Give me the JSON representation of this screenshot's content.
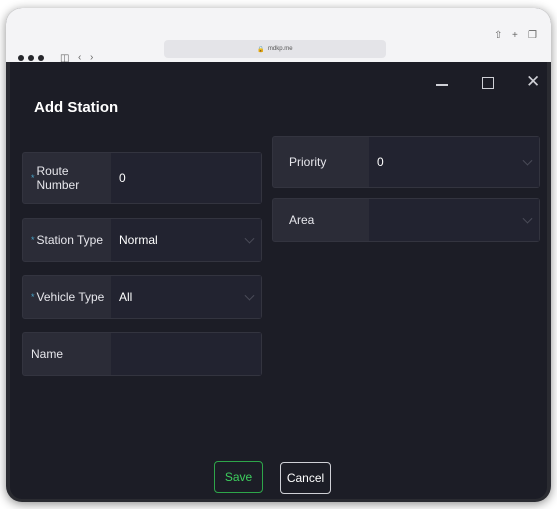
{
  "browser": {
    "url": "mdkp.me"
  },
  "modal": {
    "title": "Add Station"
  },
  "form": {
    "route_number": {
      "label_line1": "Route",
      "label_line2": "Number",
      "value": "0",
      "required": true
    },
    "station_type": {
      "label": "Station Type",
      "value": "Normal",
      "required": true
    },
    "vehicle_type": {
      "label": "Vehicle Type",
      "value": "All",
      "required": true
    },
    "name": {
      "label": "Name",
      "value": ""
    },
    "priority": {
      "label": "Priority",
      "value": "0"
    },
    "area": {
      "label": "Area",
      "value": ""
    }
  },
  "buttons": {
    "save": "Save",
    "cancel": "Cancel"
  },
  "colors": {
    "accent_required": "#4aa3c6",
    "save_green": "#2ea64a",
    "modal_bg": "#1c1d26"
  },
  "icons": [
    "share-icon",
    "plus-icon",
    "tabs-icon",
    "sidebar-icon",
    "back-icon",
    "forward-icon",
    "lock-icon",
    "minimize-icon",
    "maximize-icon",
    "close-icon",
    "chevron-down-icon"
  ]
}
